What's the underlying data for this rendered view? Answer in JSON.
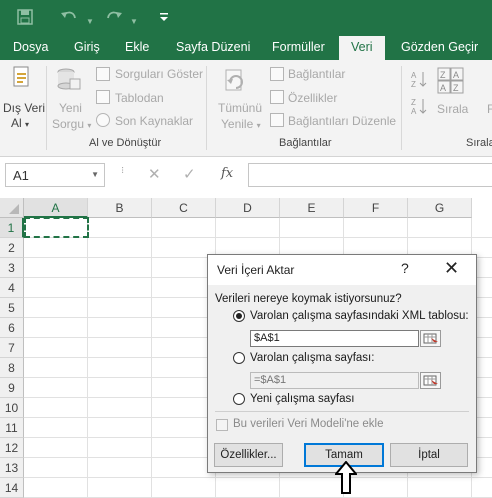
{
  "qat": {
    "save_icon": "save-icon",
    "undo_icon": "undo-icon",
    "redo_icon": "redo-icon",
    "customize_icon": "customize-qat-icon"
  },
  "tabs": [
    {
      "label": "Dosya"
    },
    {
      "label": "Giriş"
    },
    {
      "label": "Ekle"
    },
    {
      "label": "Sayfa Düzeni"
    },
    {
      "label": "Formüller"
    },
    {
      "label": "Veri",
      "active": true
    },
    {
      "label": "Gözden Geçir"
    }
  ],
  "ribbon": {
    "dis_veri_line1": "Dış Veri",
    "dis_veri_line2": "Al",
    "yeni_sorgu_line1": "Yeni",
    "yeni_sorgu_line2": "Sorgu",
    "sorgulari_goster": "Sorguları Göster",
    "tablodan": "Tablodan",
    "son_kaynaklar": "Son Kaynaklar",
    "group_al_donustur": "Al ve Dönüştür",
    "tumunu_line1": "Tümünü",
    "tumunu_line2": "Yenile",
    "baglantilar": "Bağlantılar",
    "ozellikler": "Özellikler",
    "baglantilari_duzenle": "Bağlantıları Düzenle",
    "group_baglantilar": "Bağlantılar",
    "sirala": "Sırala",
    "group_sirala": "Sırala"
  },
  "formula_bar": {
    "name_box": "A1",
    "cancel_icon": "cancel-icon",
    "enter_icon": "enter-icon",
    "fx_label": "fx",
    "formula": ""
  },
  "grid": {
    "columns": [
      "A",
      "B",
      "C",
      "D",
      "E",
      "F",
      "G"
    ],
    "rows": [
      "1",
      "2",
      "3",
      "4",
      "5",
      "6",
      "7",
      "8",
      "9",
      "10",
      "11",
      "12",
      "13",
      "14"
    ],
    "selected_cell": "A1"
  },
  "dialog": {
    "title": "Veri İçeri Aktar",
    "help": "?",
    "close": "✕",
    "question": "Verileri nereye koymak istiyorsunuz?",
    "opt1_label": "Varolan çalışma sayfasındaki XML tablosu:",
    "opt1_value": "$A$1",
    "opt2_label": "Varolan çalışma sayfası:",
    "opt2_value": "=$A$1",
    "opt3_label": "Yeni çalışma sayfası",
    "data_model_label": "Bu verileri Veri Modeli'ne ekle",
    "btn_properties": "Özellikler...",
    "btn_ok": "Tamam",
    "btn_cancel": "İptal",
    "selected_option": 1
  },
  "annotation": {
    "pointer_icon": "up-arrow-icon"
  }
}
